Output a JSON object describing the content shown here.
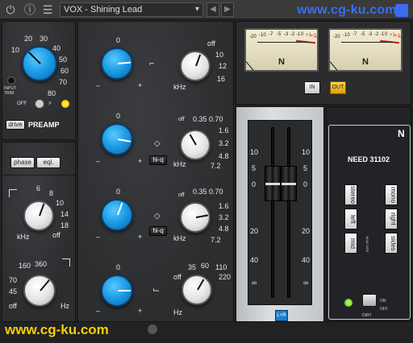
{
  "topbar": {
    "preset_name": "VOX - Shining Lead",
    "watermark": "www.cg-ku.com",
    "icons": [
      "power-icon",
      "info-icon",
      "settings-sliders-icon",
      "chevron-down-icon",
      "arrow-left-icon",
      "arrow-right-icon"
    ]
  },
  "preamp": {
    "scale": [
      "10",
      "20",
      "30",
      "40",
      "50",
      "60",
      "70",
      "80"
    ],
    "input_trim_label": "INPUT\nTRIM",
    "off_label": "OFF",
    "drive_label": "drive",
    "preamp_label": "PREAMP"
  },
  "filters": {
    "phase_label": "phase",
    "eql_label": "eql.",
    "lowpass_scale": [
      "6",
      "8",
      "10",
      "14",
      "18",
      "off"
    ],
    "lowpass_unit": "kHz",
    "highpass_scale": [
      "160",
      "360",
      "70",
      "45",
      "off"
    ],
    "highpass_unit": "Hz"
  },
  "eq_bands": [
    {
      "gain_top": "0",
      "freq_scale": [
        "off",
        "10",
        "12",
        "16"
      ],
      "freq_unit": "kHz",
      "hiq": ""
    },
    {
      "gain_top": "0",
      "freq_scale": [
        "0.35",
        "0.70",
        "off",
        "1.6",
        "3.2",
        "4.8",
        "7.2"
      ],
      "freq_unit": "kHz",
      "hiq": "hi-q"
    },
    {
      "gain_top": "0",
      "freq_scale": [
        "0.35",
        "0.70",
        "off",
        "1.6",
        "3.2",
        "4.8",
        "7.2"
      ],
      "freq_unit": "kHz",
      "hiq": "hi-q"
    },
    {
      "gain_top": "0",
      "freq_scale": [
        "35",
        "60",
        "110",
        "off",
        "220"
      ],
      "freq_unit": "Hz",
      "hiq": ""
    }
  ],
  "meters": {
    "scale": [
      "-20",
      "-10",
      "-7",
      "-5",
      "-3",
      "-2",
      "-1",
      "0",
      "+1",
      "+2",
      "+3"
    ],
    "logo": "N",
    "in_label": "IN",
    "out_label": "OUT"
  },
  "faders": {
    "scale_left": [
      "10",
      "5",
      "0",
      "20",
      "40",
      "∞"
    ],
    "scale_right": [
      "10",
      "5",
      "0",
      "20",
      "40",
      "∞"
    ],
    "link_label": "L+R"
  },
  "bus": {
    "logo": "N",
    "title": "NEED 31102",
    "stereo_label": "stereo",
    "left_label": "left",
    "mid_label": "mid",
    "mono_label": "mono",
    "right_label": "right",
    "sides_label": "sides",
    "ms_label": "MIDE SIDE",
    "on_label": "ON",
    "off_label": "OFF",
    "dirt_label": "DIRT"
  },
  "colors": {
    "accent_blue": "#1e9ee8",
    "led_green": "#7ddc2b",
    "led_yellow": "#ffd000",
    "out_btn": "#f0b400",
    "watermark_blue": "#3a6df0",
    "watermark_yellow": "#f5d000"
  }
}
